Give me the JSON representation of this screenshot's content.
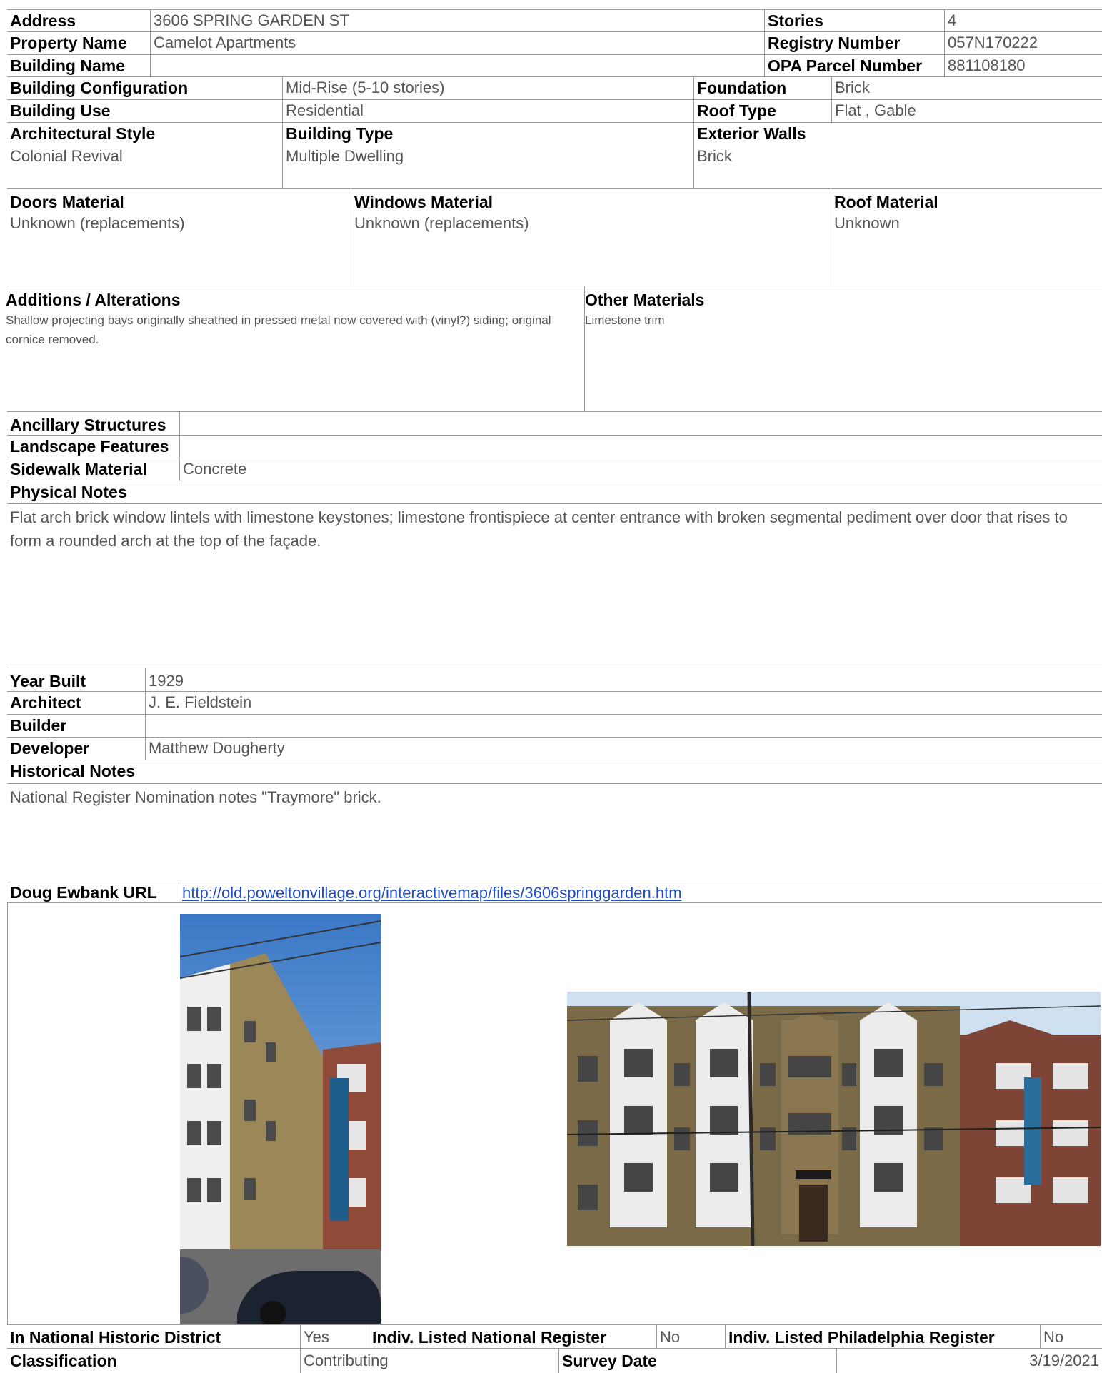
{
  "header": {
    "address_label": "Address",
    "address": "3606 SPRING GARDEN ST",
    "stories_label": "Stories",
    "stories": "4",
    "property_name_label": "Property Name",
    "property_name": "Camelot Apartments",
    "registry_label": "Registry Number",
    "registry": "057N170222",
    "building_name_label": "Building Name",
    "building_name": "",
    "opa_label": "OPA Parcel Number",
    "opa": "881108180"
  },
  "building": {
    "config_label": "Building Configuration",
    "config": "Mid-Rise (5-10 stories)",
    "foundation_label": "Foundation",
    "foundation": "Brick",
    "use_label": "Building Use",
    "use": "Residential",
    "roof_type_label": "Roof Type",
    "roof_type": "Flat , Gable",
    "arch_style_label": "Architectural Style",
    "arch_style": "Colonial Revival",
    "building_type_label": "Building Type",
    "building_type": "Multiple Dwelling",
    "exterior_walls_label": "Exterior Walls",
    "exterior_walls": "Brick"
  },
  "materials": {
    "doors_label": "Doors Material",
    "doors": "Unknown (replacements)",
    "windows_label": "Windows Material",
    "windows": "Unknown (replacements)",
    "roof_label": "Roof Material",
    "roof": "Unknown",
    "additions_label": "Additions / Alterations",
    "additions": "Shallow projecting bays originally sheathed in pressed metal now covered with (vinyl?) siding; original cornice removed.",
    "other_label": "Other Materials",
    "other": "Limestone trim"
  },
  "site": {
    "ancillary_label": "Ancillary Structures",
    "ancillary": "",
    "landscape_label": "Landscape Features",
    "landscape": "",
    "sidewalk_label": "Sidewalk Material",
    "sidewalk": "Concrete",
    "physical_notes_label": "Physical Notes",
    "physical_notes": "Flat arch brick window lintels with limestone keystones; limestone frontispiece at center entrance with broken segmental pediment over door that rises to form a rounded arch at the top of the façade."
  },
  "history": {
    "year_label": "Year Built",
    "year": "1929",
    "architect_label": "Architect",
    "architect": "J. E. Fieldstein",
    "builder_label": "Builder",
    "builder": "",
    "developer_label": "Developer",
    "developer": "Matthew Dougherty",
    "notes_label": "Historical Notes",
    "notes": "National Register Nomination notes \"Traymore\" brick.",
    "url_label": "Doug Ewbank URL",
    "url": "http://old.poweltonvillage.org/interactivemap/files/3606springgarden.htm"
  },
  "footer": {
    "district_label": "In National Historic District",
    "district": "Yes",
    "nat_reg_label": "Indiv. Listed National Register",
    "nat_reg": "No",
    "phila_reg_label": "Indiv. Listed Philadelphia Register",
    "phila_reg": "No",
    "classification_label": "Classification",
    "classification": "Contributing",
    "survey_label": "Survey Date",
    "survey": "3/19/2021"
  },
  "colors": {
    "label_text": "#000000",
    "value_text": "#555555",
    "grid": "#9a9a9a",
    "link": "#1f4fbf"
  }
}
